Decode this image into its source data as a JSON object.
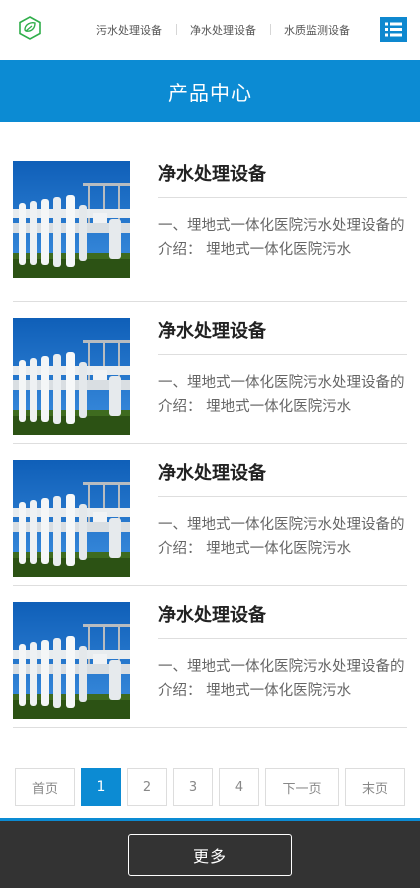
{
  "header": {
    "logo_icon": "recycle-leaf-icon",
    "nav": [
      "污水处理设备",
      "净水处理设备",
      "水质监测设备"
    ],
    "menu_icon": "list-menu-icon",
    "accent": "#0c8bd3"
  },
  "banner": {
    "title": "产品中心"
  },
  "products": [
    {
      "title": "净水处理设备",
      "desc": "一、埋地式一体化医院污水处理设备的介绍： 埋地式一体化医院污水"
    },
    {
      "title": "净水处理设备",
      "desc": "一、埋地式一体化医院污水处理设备的介绍： 埋地式一体化医院污水"
    },
    {
      "title": "净水处理设备",
      "desc": "一、埋地式一体化医院污水处理设备的介绍： 埋地式一体化医院污水"
    },
    {
      "title": "净水处理设备",
      "desc": "一、埋地式一体化医院污水处理设备的介绍： 埋地式一体化医院污水"
    }
  ],
  "pagination": {
    "first": "首页",
    "pages": [
      "1",
      "2",
      "3",
      "4"
    ],
    "current": "1",
    "next": "下一页",
    "last": "末页"
  },
  "footer": {
    "more_label": "更多"
  }
}
